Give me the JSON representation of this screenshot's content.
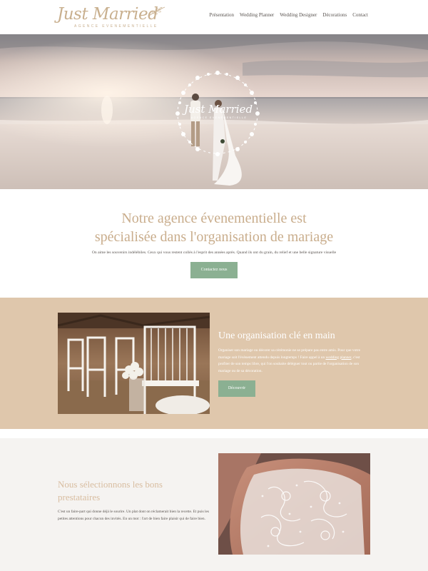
{
  "header": {
    "logo_text": "Just Married",
    "logo_subtitle": "AGENCE EVENEMENTIELLE",
    "nav": [
      "Présentation",
      "Wedding Planner",
      "Wedding Designer",
      "Décorations",
      "Contact"
    ]
  },
  "hero": {
    "overlay_title": "Just Married",
    "overlay_subtitle": "AGENCE EVENEMENTIELLE"
  },
  "intro": {
    "title_line1": "Notre agence évenementielle est",
    "title_line2": "spécialisée dans l'organisation de mariage",
    "text": "On aime les souvenirs indélébiles. Ceux qui vous restent collés à l'esprit des années après. Quand ils ont du grain, du relief et une belle signature visuelle",
    "button": "Contactez nous"
  },
  "section_turnkey": {
    "title": "Une organisation clé en main",
    "text_before_link": "Organiser son mariage ou décorer sa cérémonie ne se prépare pas entre amis. Pour que votre mariage soit l'évènement attendu depuis longtemps ! Faire appel à un",
    "link": "wedding planner",
    "text_after_link": ", c'est profiter de son temps libre, qui l'on souhaite déléguer tout ou partie de l'organisation de son mariage ou de sa décoration.",
    "button": "Découvrir"
  },
  "section_providers": {
    "title": "Nous sélectionnons les bons prestataires",
    "text": "C'est un faire-part qui donne déjà le sourire. Un plat dont on réclamerait bien la recette. Et puis les petites attentions pour chacun des invités. En un mot : l'art de bien faire plaisir qui de faire bien."
  },
  "colors": {
    "accent_gold": "#c9ad8c",
    "button_green": "#8bb092",
    "beige_section": "#dfc7ac",
    "light_section": "#f5f3f1"
  },
  "icons": {
    "logo_ornament": "leaf-branch-icon",
    "hero_wreath": "floral-wreath-icon"
  }
}
